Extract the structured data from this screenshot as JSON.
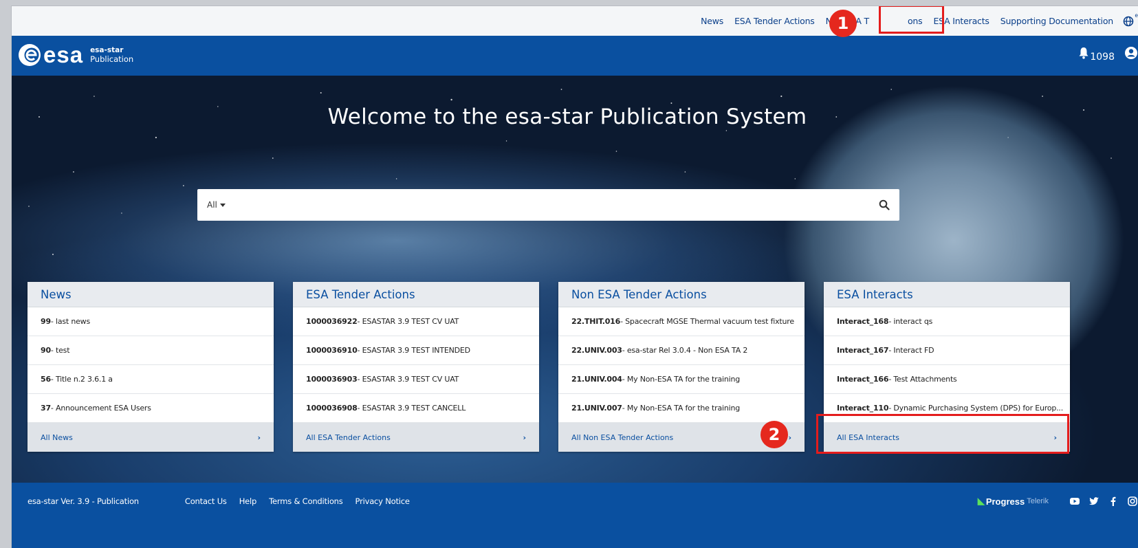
{
  "topnav": {
    "links": [
      "News",
      "ESA Tender Actions",
      "Non ESA Tender Actions",
      "ESA Interacts",
      "Supporting Documentation"
    ],
    "visible_texts": [
      "News",
      "ESA Tender Actions",
      "Non ESA T",
      "ons",
      "ESA Interacts",
      "Supporting Documentation"
    ],
    "language_icon": "globe-icon",
    "language_letter": "e"
  },
  "header": {
    "logo_word": "esa",
    "logo_line1": "esa-star",
    "logo_line2": "Publication",
    "notification_count": "1098",
    "bell_icon": "bell-icon",
    "user_icon": "user-circle-icon"
  },
  "hero": {
    "title": "Welcome to the esa-star Publication System",
    "search_scope": "All",
    "search_placeholder": "",
    "search_icon": "search-icon"
  },
  "cards": [
    {
      "title": "News",
      "rows": [
        {
          "id": "99",
          "text": " - last news"
        },
        {
          "id": "90",
          "text": " - test"
        },
        {
          "id": "56",
          "text": " - Title n.2 3.6.1 a"
        },
        {
          "id": "37",
          "text": " - Announcement ESA Users"
        }
      ],
      "footer": "All News"
    },
    {
      "title": "ESA Tender Actions",
      "rows": [
        {
          "id": "1000036922",
          "text": " - ESASTAR 3.9 TEST CV UAT"
        },
        {
          "id": "1000036910",
          "text": " - ESASTAR 3.9 TEST INTENDED"
        },
        {
          "id": "1000036903",
          "text": " - ESASTAR 3.9 TEST CV UAT"
        },
        {
          "id": "1000036908",
          "text": " - ESASTAR 3.9 TEST CANCELL"
        }
      ],
      "footer": "All ESA Tender Actions"
    },
    {
      "title": "Non ESA Tender Actions",
      "rows": [
        {
          "id": "22.THIT.016",
          "text": " - Spacecraft MGSE Thermal vacuum test fixture"
        },
        {
          "id": "22.UNIV.003",
          "text": " - esa-star Rel 3.0.4 - Non ESA TA 2"
        },
        {
          "id": "21.UNIV.004",
          "text": " - My Non-ESA TA for the training"
        },
        {
          "id": "21.UNIV.007",
          "text": " - My Non-ESA TA for the training"
        }
      ],
      "footer": "All Non ESA Tender Actions"
    },
    {
      "title": "ESA Interacts",
      "rows": [
        {
          "id": "Interact_168",
          "text": " - interact qs"
        },
        {
          "id": "Interact_167",
          "text": " - Interact FD"
        },
        {
          "id": "Interact_166",
          "text": " - Test Attachments"
        },
        {
          "id": "Interact_110",
          "text": " - Dynamic Purchasing System (DPS) for Europ..."
        }
      ],
      "footer": "All ESA Interacts"
    }
  ],
  "footer": {
    "version": "esa-star Ver. 3.9 - Publication",
    "links": [
      "Contact Us",
      "Help",
      "Terms & Conditions",
      "Privacy Notice"
    ],
    "telerik_word1": "Progress",
    "telerik_word2": "Telerik",
    "social_icons": [
      "youtube-icon",
      "twitter-icon",
      "facebook-icon",
      "instagram-icon"
    ]
  },
  "annotations": {
    "badge1": "1",
    "badge2": "2",
    "color": "#e41c1c"
  },
  "colors": {
    "brand_blue": "#0a50a0",
    "link_blue": "#0a4fa0"
  }
}
